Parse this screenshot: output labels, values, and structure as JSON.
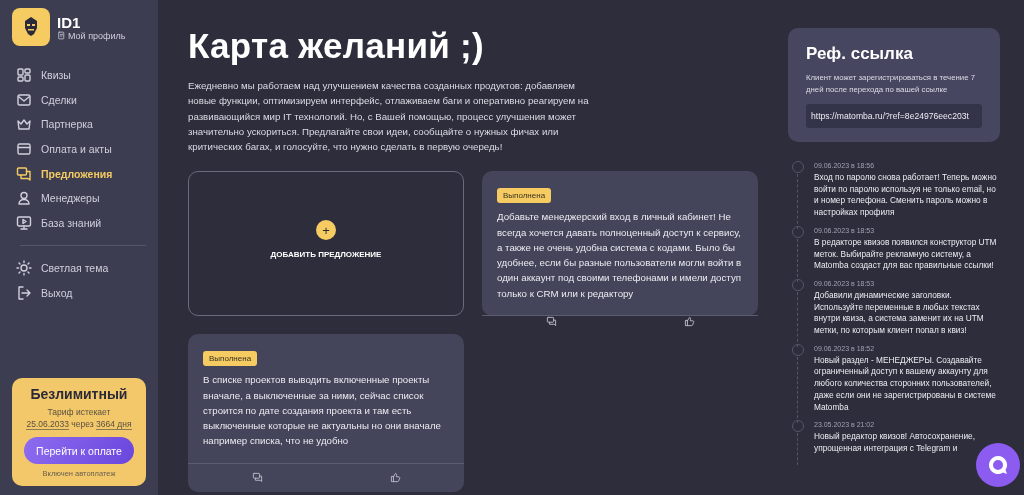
{
  "profile": {
    "name": "ID1",
    "link": "Мой профиль"
  },
  "nav": [
    {
      "label": "Квизы",
      "selected": false
    },
    {
      "label": "Сделки",
      "selected": false
    },
    {
      "label": "Партнерка",
      "selected": false
    },
    {
      "label": "Оплата и акты",
      "selected": false
    },
    {
      "label": "Предложения",
      "selected": true
    },
    {
      "label": "Менеджеры",
      "selected": false
    },
    {
      "label": "База знаний",
      "selected": false
    }
  ],
  "secondary_nav": [
    {
      "label": "Светлая тема"
    },
    {
      "label": "Выход"
    }
  ],
  "plan": {
    "name": "Безлимитный",
    "expires": "Тариф истекает",
    "date": "25.06.2033",
    "through": "через",
    "days": "3664 дня",
    "button": "Перейти к оплате",
    "note": "Включен автоплатеж"
  },
  "page": {
    "title": "Карта желаний ;)",
    "intro": "Ежедневно мы работаем над улучшением качества созданных продуктов: добавляем новые функции, оптимизируем интерфейс, отлаживаем баги и оперативно реагируем на развивающийся мир IT технологий. Но, с Вашей помощью, процесс улучшения может значительно ускориться. Предлагайте свои идеи, сообщайте о нужных фичах или критических багах, и голосуйте, что нужно сделать в первую очередь!"
  },
  "add_card": {
    "icon": "+",
    "label": "ДОБАВИТЬ ПРЕДЛОЖЕНИЕ"
  },
  "suggestions": [
    {
      "status": "Выполнена",
      "text": "Добавьте менеджерский вход в личный кабинет! Не всегда хочется давать полноценный доступ к сервису, а также не очень удобна система с кодами. Было бы удобнее, если бы разные пользователи могли войти в один аккаунт под своими телефонами и имели доступ только к CRM или к редактору"
    },
    {
      "status": "Выполнена",
      "text": "В списке проектов выводить включенные проекты вначале, а выключенные за ними, сейчас список строится по дате создания проекта и там есть выключенные которые не актуальны но они вначале например списка, что не удобно"
    }
  ],
  "referral": {
    "title": "Реф. ссылка",
    "description": "Клиент может зарегистрироваться в течение 7 дней после перехода по вашей ссылке",
    "url": "https://matomba.ru/?ref=8e24976eec203t"
  },
  "updates": [
    {
      "date": "09.06.2023 в 18:56",
      "text": "Вход по паролю снова работает! Теперь можно войти по паролю используя не только email, но и номер телефона. Сменить пароль можно в настройках профиля"
    },
    {
      "date": "09.06.2023 в 18:53",
      "text": "В редакторе квизов появился конструктор UTM меток. Выбирайте рекламную систему, а Matomba создаст для вас правильные ссылки!"
    },
    {
      "date": "09.06.2023 в 18:53",
      "text": "Добавили динамические заголовки. Используйте переменные в любых текстах внутри квиза, а система заменит их на UTM метки, по которым клиент попал в квиз!"
    },
    {
      "date": "09.06.2023 в 18:52",
      "text": "Новый раздел - МЕНЕДЖЕРЫ. Создавайте ограниченный доступ к вашему аккаунту для любого количества сторонних пользователей, даже если они не зарегистрированы в системе Matomba"
    },
    {
      "date": "23.05.2023 в 21:02",
      "text": "Новый редактор квизов! Автосохранение, упрощенная интеграция с Telegram и"
    }
  ]
}
